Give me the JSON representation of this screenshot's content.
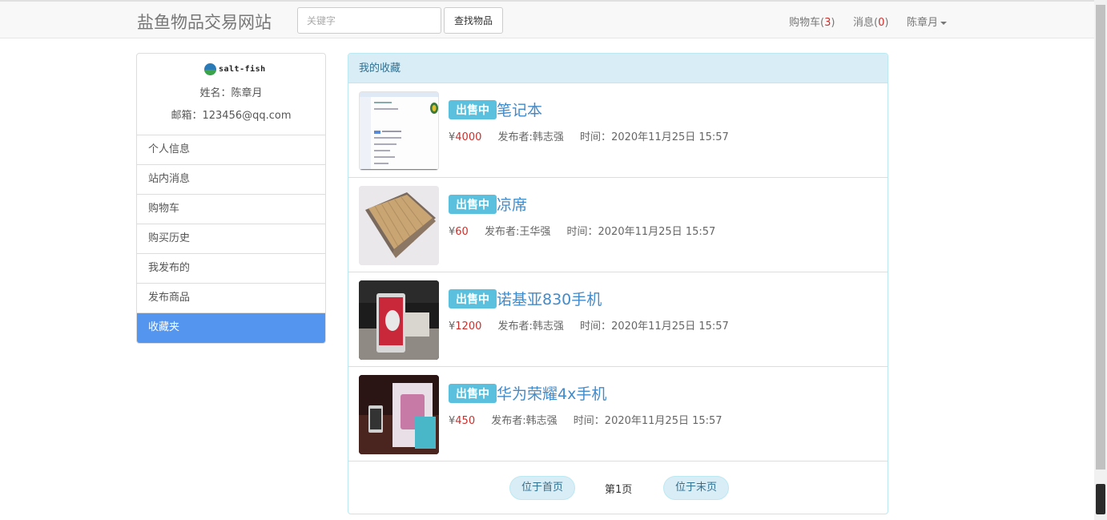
{
  "header": {
    "brand": "盐鱼物品交易网站",
    "search_placeholder": "关键字",
    "search_button": "查找物品",
    "cart_label": "购物车(",
    "cart_count": "3",
    "cart_close": ")",
    "messages_label": "消息(",
    "messages_count": "0",
    "messages_close": ")",
    "user_name": "陈章月"
  },
  "sidebar": {
    "logo_text": "salt-fish",
    "name_line": "姓名：陈章月",
    "email_line": "邮箱：123456@qq.com",
    "items": [
      {
        "label": "个人信息"
      },
      {
        "label": "站内消息"
      },
      {
        "label": "购物车"
      },
      {
        "label": "购买历史"
      },
      {
        "label": "我发布的"
      },
      {
        "label": "发布商品"
      },
      {
        "label": "收藏夹"
      }
    ],
    "active_index": 6
  },
  "favorites": {
    "heading": "我的收藏",
    "items": [
      {
        "status": "出售中",
        "title": "笔记本",
        "price_symbol": "¥",
        "price": "4000",
        "seller": "发布者:韩志强",
        "time_label": "时间：",
        "time": "2020年11月25日 15:57",
        "thumb": "screenshot-thumbnail"
      },
      {
        "status": "出售中",
        "title": "凉席",
        "price_symbol": "¥",
        "price": "60",
        "seller": "发布者:王华强",
        "time_label": "时间：",
        "time": "2020年11月25日 15:57",
        "thumb": "bamboo-mat-thumbnail"
      },
      {
        "status": "出售中",
        "title": "诺基亚830手机",
        "price_symbol": "¥",
        "price": "1200",
        "seller": "发布者:韩志强",
        "time_label": "时间：",
        "time": "2020年11月25日 15:57",
        "thumb": "phone-thumbnail"
      },
      {
        "status": "出售中",
        "title": "华为荣耀4x手机",
        "price_symbol": "¥",
        "price": "450",
        "seller": "发布者:韩志强",
        "time_label": "时间：",
        "time": "2020年11月25日 15:57",
        "thumb": "phone-box-thumbnail"
      }
    ]
  },
  "pagination": {
    "first": "位于首页",
    "current_prefix": "第",
    "current_page": "1",
    "current_suffix": "页",
    "last": "位于末页"
  },
  "colors": {
    "accent": "#5495f0",
    "badge": "#5bc0de",
    "price": "#c9302c",
    "link": "#428bca"
  }
}
